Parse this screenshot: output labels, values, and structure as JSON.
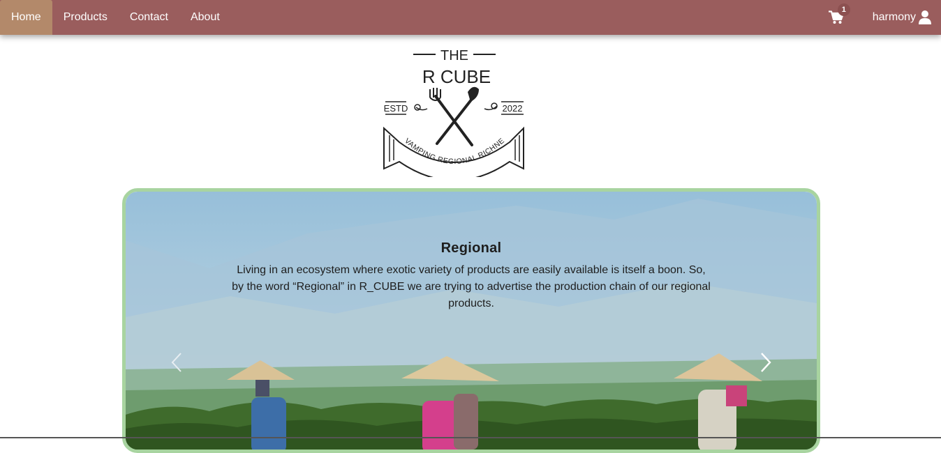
{
  "nav": {
    "items": [
      {
        "label": "Home",
        "active": true
      },
      {
        "label": "Products",
        "active": false
      },
      {
        "label": "Contact",
        "active": false
      },
      {
        "label": "About",
        "active": false
      }
    ],
    "cart_count": "1",
    "username": "harmony",
    "colors": {
      "bar": "#9a5d5d",
      "active": "#b3896a"
    }
  },
  "logo": {
    "line1": "THE",
    "line2": "R CUBE",
    "left_tag": "ESTD",
    "right_tag": "2022",
    "banner": "REVAMPING REGIONAL RICHNESS"
  },
  "carousel": {
    "title": "Regional",
    "text": "Living in an ecosystem where exotic variety of products are easily available is itself a boon. So, by the word “Regional” in R_CUBE we are trying to advertise the production chain of our regional products.",
    "border_color": "#a8d4a0"
  }
}
